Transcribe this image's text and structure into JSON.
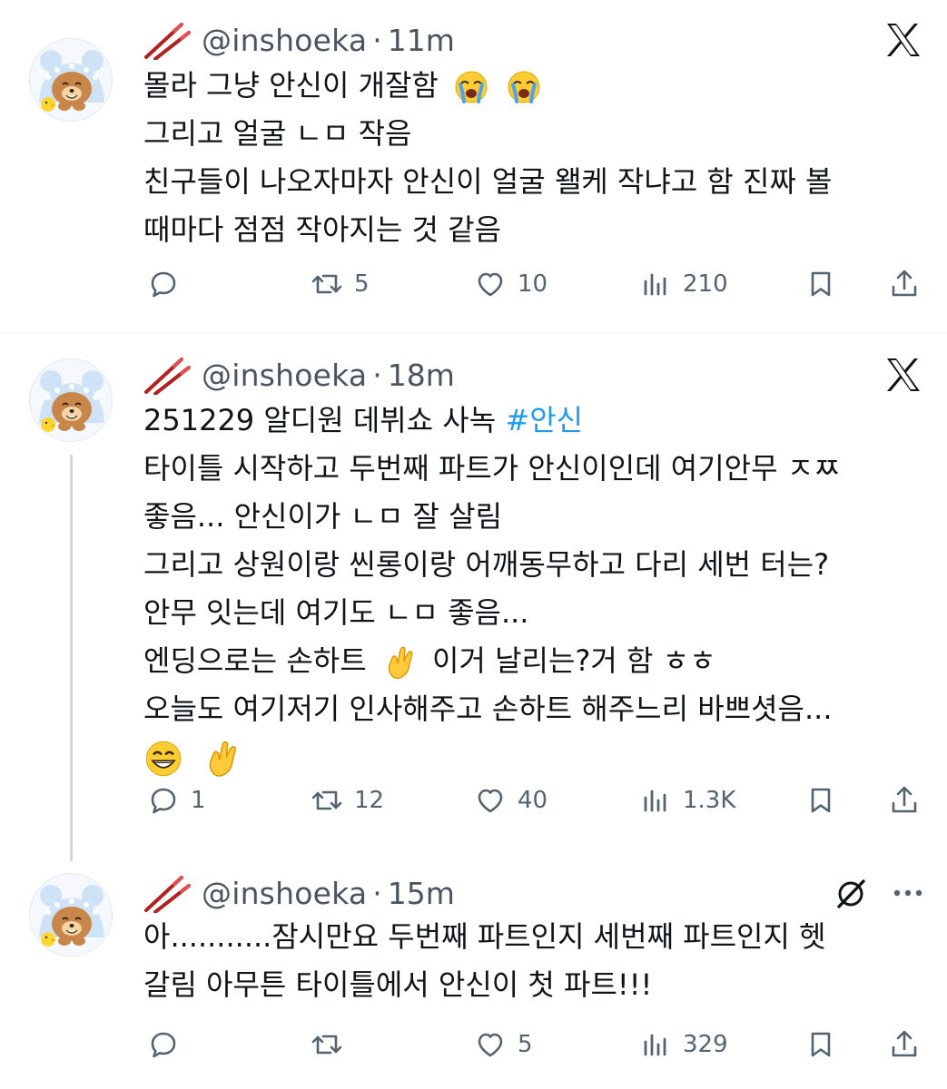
{
  "tweets": [
    {
      "name": "tweet-1",
      "handle": "@inshoeka",
      "dot": "·",
      "time": "11m",
      "lines": [
        "몰라 그냥 안신이 개잘함",
        "그리고 얼굴 ㄴㅁ 작음",
        "친구들이 나오자마자 안신이 얼굴 왤케 작냐고 함 진짜 볼",
        "때마다 점점 작아지는 것 같음"
      ],
      "actions": {
        "reply": "",
        "retweet": "5",
        "like": "10",
        "views": "210"
      }
    },
    {
      "name": "tweet-2",
      "handle": "@inshoeka",
      "dot": "·",
      "time": "18m",
      "line1_prefix": "251229 알디원 데뷔쇼 사녹 ",
      "hashtag": "#안신",
      "lines": [
        "타이틀 시작하고 두번째 파트가 안신이인데 여기안무 ㅈㅉ",
        "좋음... 안신이가 ㄴㅁ 잘 살림",
        "그리고 상원이랑 씬롱이랑 어깨동무하고 다리 세번 터는?",
        "안무 잇는데 여기도 ㄴㅁ 좋음..."
      ],
      "line6_a": "엔딩으로는 손하트",
      "line6_b": "이거 날리는?거 함 ㅎㅎ",
      "line7": "오늘도 여기저기 인사해주고 손하트 해주느리 바쁘셧음...",
      "actions": {
        "reply": "1",
        "retweet": "12",
        "like": "40",
        "views": "1.3K"
      }
    },
    {
      "name": "tweet-3",
      "handle": "@inshoeka",
      "dot": "·",
      "time": "15m",
      "lines": [
        "아...........잠시만요 두번째 파트인지 세번째 파트인지 헷",
        "갈림 아무튼 타이틀에서 안신이 첫 파트!!!"
      ],
      "actions": {
        "reply": "",
        "retweet": "",
        "like": "5",
        "views": "329"
      }
    }
  ],
  "icons": {
    "platform": "x-logo-icon",
    "grok": "grok-icon",
    "more": "more-icon",
    "reply": "reply-icon",
    "retweet": "retweet-icon",
    "like": "heart-icon",
    "views": "views-icon",
    "bookmark": "bookmark-icon",
    "share": "share-icon"
  },
  "colors": {
    "text": "#0f1419",
    "secondary": "#536471",
    "link": "#1d9bf0",
    "divider": "#eff3f4"
  }
}
